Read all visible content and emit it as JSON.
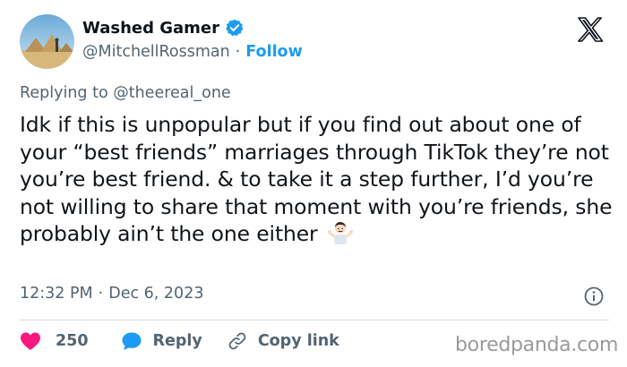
{
  "author": {
    "display_name": "Washed Gamer",
    "handle": "@MitchellRossman",
    "separator": "·",
    "follow_label": "Follow"
  },
  "reply_context": {
    "prefix": "Replying to ",
    "mention": "@theereal_one"
  },
  "tweet": {
    "text": "Idk if this is unpopular but if you find out about one of your “best friends” marriages through TikTok they’re not you’re best friend. & to take it a step further, I’d you’re not willing to share that moment with you’re friends, she probably ain’t the one either",
    "emoji": "man-shrugging-emoji"
  },
  "timestamp": {
    "time": "12:32 PM",
    "separator": "·",
    "date": "Dec 6, 2023"
  },
  "actions": {
    "like_count": "250",
    "reply_label": "Reply",
    "copy_link_label": "Copy link"
  },
  "watermark": "boredpanda.com",
  "icons": {
    "verified": "verified-badge-icon",
    "platform": "x-logo-icon",
    "info": "info-icon",
    "like": "heart-icon",
    "reply": "speech-bubble-icon",
    "copy": "link-icon"
  },
  "colors": {
    "accent": "#1d9bf0",
    "like": "#f91880",
    "text_secondary": "#536471",
    "text_primary": "#0f1419"
  }
}
